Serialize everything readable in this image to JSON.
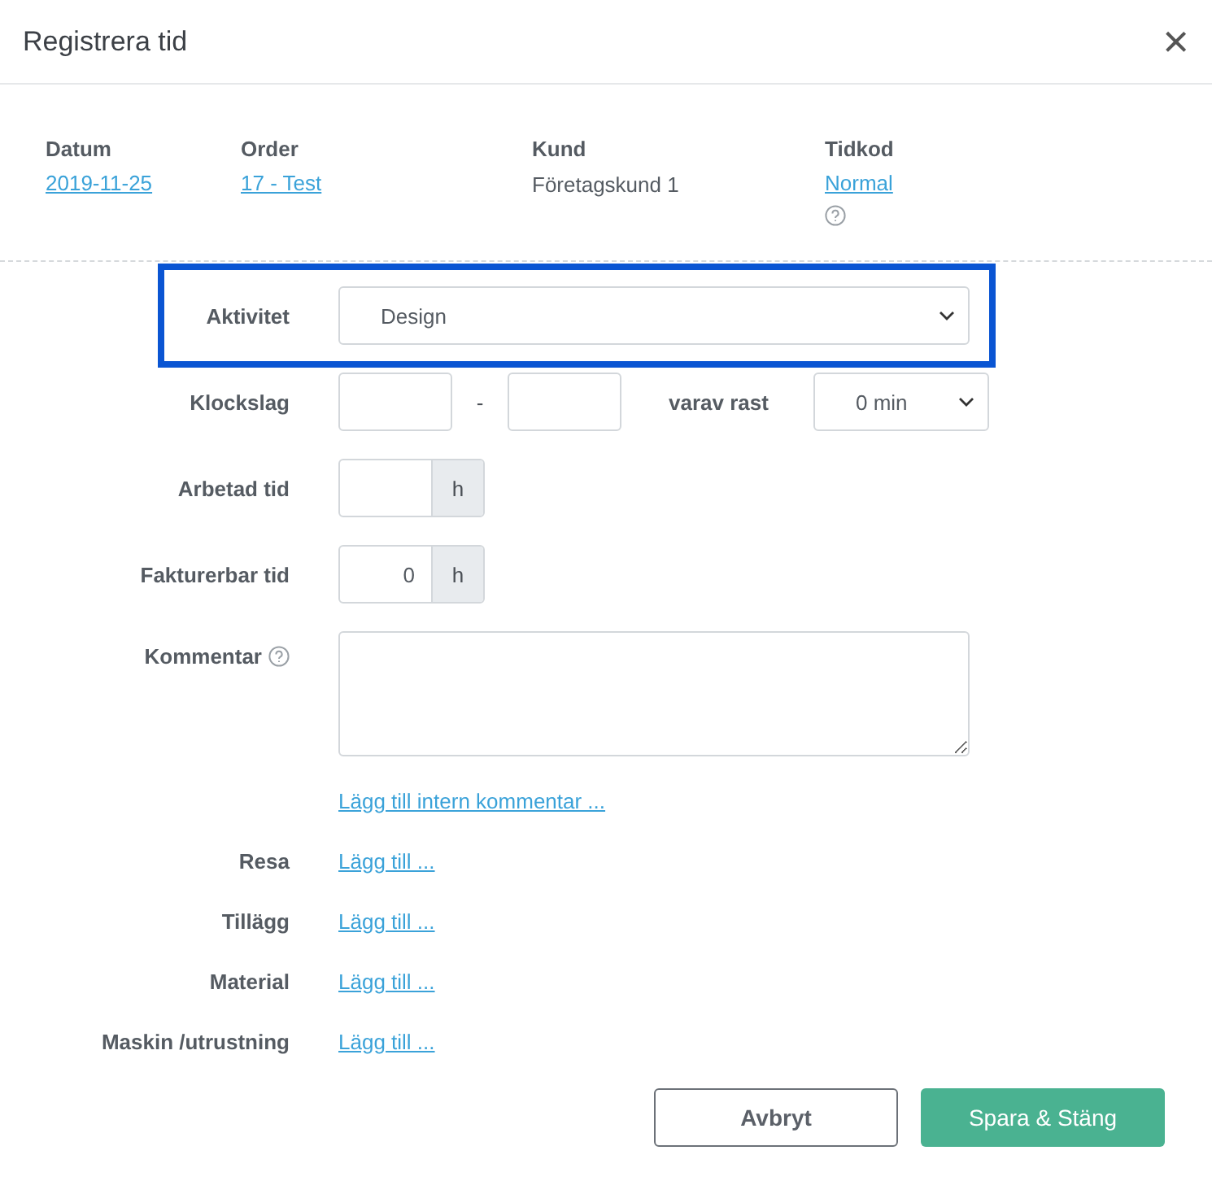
{
  "dialog": {
    "title": "Registrera tid",
    "close": "×"
  },
  "info": [
    {
      "label": "Datum",
      "value": "2019-11-25",
      "link": true,
      "help": false
    },
    {
      "label": "Order",
      "value": "17 - Test",
      "link": true,
      "help": false
    },
    {
      "label": "Kund",
      "value": "Företagskund 1",
      "link": false,
      "help": false
    },
    {
      "label": "Tidkod",
      "value": "Normal",
      "link": true,
      "help": true
    }
  ],
  "form": [
    {
      "kind": "select",
      "label": "Aktivitet",
      "value": "Design",
      "highlighted": true
    },
    {
      "kind": "time_range",
      "label": "Klockslag",
      "separator": "-",
      "break_label": "varav rast",
      "break_value": "0 min",
      "highlighted": false
    },
    {
      "kind": "hours",
      "label": "Arbetad tid",
      "unit": "h",
      "highlighted": false
    },
    {
      "kind": "hours",
      "label": "Fakturerbar tid",
      "value": "0",
      "unit": "h",
      "highlighted": false
    },
    {
      "kind": "textarea",
      "label": "Kommentar",
      "help": true,
      "highlighted": false
    },
    {
      "kind": "link",
      "link": "Lägg till intern kommentar ...",
      "highlighted": false
    },
    {
      "kind": "link",
      "label": "Resa",
      "link": "Lägg till ...",
      "highlighted": false
    },
    {
      "kind": "link",
      "label": "Tillägg",
      "link": "Lägg till ...",
      "highlighted": false
    },
    {
      "kind": "link",
      "label": "Material",
      "link": "Lägg till ...",
      "highlighted": false
    },
    {
      "kind": "link",
      "label": "Maskin /utrustning",
      "link": "Lägg till ...",
      "highlighted": false
    }
  ],
  "buttons": {
    "cancel": "Avbryt",
    "save": "Spara & Stäng"
  }
}
